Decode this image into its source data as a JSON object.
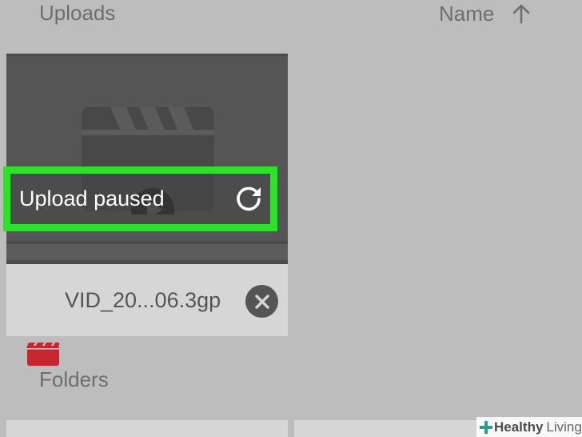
{
  "uploads_section": {
    "title": "Uploads",
    "sort": {
      "label": "Name",
      "direction_icon": "arrow-up-icon"
    }
  },
  "upload_item": {
    "status": "Upload paused",
    "retry_icon": "refresh-icon",
    "thumbnail_icon": "video-clapper-icon",
    "file_type_icon": "video-file-icon",
    "file_name": "VID_20...06.3gp",
    "cancel_icon": "close-icon"
  },
  "folders_section": {
    "title": "Folders"
  },
  "watermark": {
    "bold": "Healthy",
    "light": "Living"
  },
  "colors": {
    "highlight": "#2fe12d",
    "file_icon": "#c6262e",
    "background": "#bdbdbd",
    "card": "#d6d6d6",
    "thumbnail": "#555555"
  }
}
